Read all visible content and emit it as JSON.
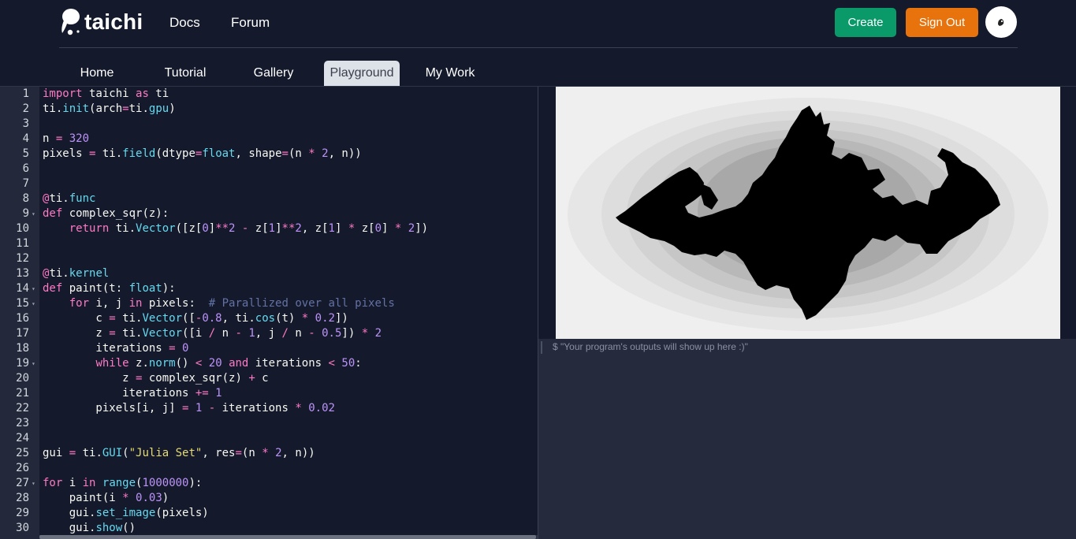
{
  "brand": {
    "name": "taichi"
  },
  "nav": {
    "docs": "Docs",
    "forum": "Forum"
  },
  "actions": {
    "create": "Create",
    "sign_out": "Sign Out",
    "create_color": "#0a9a6a",
    "sign_out_color": "#e8730c"
  },
  "tabs": [
    "Home",
    "Tutorial",
    "Gallery",
    "Playground",
    "My Work"
  ],
  "active_tab": "Playground",
  "code": [
    [
      [
        "k",
        "import"
      ],
      [
        "t",
        " taichi "
      ],
      [
        "k",
        "as"
      ],
      [
        "t",
        " ti"
      ]
    ],
    [
      [
        "t",
        "ti."
      ],
      [
        "f",
        "init"
      ],
      [
        "t",
        "(arch"
      ],
      [
        "k",
        "="
      ],
      [
        "t",
        "ti."
      ],
      [
        "f",
        "gpu"
      ],
      [
        "t",
        ")"
      ]
    ],
    [],
    [
      [
        "t",
        "n "
      ],
      [
        "k",
        "="
      ],
      [
        "t",
        " "
      ],
      [
        "n",
        "320"
      ]
    ],
    [
      [
        "t",
        "pixels "
      ],
      [
        "k",
        "="
      ],
      [
        "t",
        " ti."
      ],
      [
        "f",
        "field"
      ],
      [
        "t",
        "(dtype"
      ],
      [
        "k",
        "="
      ],
      [
        "f",
        "float"
      ],
      [
        "t",
        ", shape"
      ],
      [
        "k",
        "="
      ],
      [
        "t",
        "(n "
      ],
      [
        "k",
        "*"
      ],
      [
        "t",
        " "
      ],
      [
        "n",
        "2"
      ],
      [
        "t",
        ", n))"
      ]
    ],
    [],
    [],
    [
      [
        "k",
        "@"
      ],
      [
        "t",
        "ti."
      ],
      [
        "f",
        "func"
      ]
    ],
    [
      [
        "k",
        "def"
      ],
      [
        "t",
        " complex_sqr(z):"
      ]
    ],
    [
      [
        "t",
        "    "
      ],
      [
        "k",
        "return"
      ],
      [
        "t",
        " ti."
      ],
      [
        "f",
        "Vector"
      ],
      [
        "t",
        "([z["
      ],
      [
        "n",
        "0"
      ],
      [
        "t",
        "]"
      ],
      [
        "k",
        "**"
      ],
      [
        "n",
        "2"
      ],
      [
        "t",
        " "
      ],
      [
        "k",
        "-"
      ],
      [
        "t",
        " z["
      ],
      [
        "n",
        "1"
      ],
      [
        "t",
        "]"
      ],
      [
        "k",
        "**"
      ],
      [
        "n",
        "2"
      ],
      [
        "t",
        ", z["
      ],
      [
        "n",
        "1"
      ],
      [
        "t",
        "] "
      ],
      [
        "k",
        "*"
      ],
      [
        "t",
        " z["
      ],
      [
        "n",
        "0"
      ],
      [
        "t",
        "] "
      ],
      [
        "k",
        "*"
      ],
      [
        "t",
        " "
      ],
      [
        "n",
        "2"
      ],
      [
        "t",
        "])"
      ]
    ],
    [],
    [],
    [
      [
        "k",
        "@"
      ],
      [
        "t",
        "ti."
      ],
      [
        "f",
        "kernel"
      ]
    ],
    [
      [
        "k",
        "def"
      ],
      [
        "t",
        " paint(t: "
      ],
      [
        "f",
        "float"
      ],
      [
        "t",
        "):"
      ]
    ],
    [
      [
        "t",
        "    "
      ],
      [
        "k",
        "for"
      ],
      [
        "t",
        " i, j "
      ],
      [
        "k",
        "in"
      ],
      [
        "t",
        " pixels:  "
      ],
      [
        "c",
        "# Parallized over all pixels"
      ]
    ],
    [
      [
        "t",
        "        c "
      ],
      [
        "k",
        "="
      ],
      [
        "t",
        " ti."
      ],
      [
        "f",
        "Vector"
      ],
      [
        "t",
        "(["
      ],
      [
        "k",
        "-"
      ],
      [
        "n",
        "0.8"
      ],
      [
        "t",
        ", ti."
      ],
      [
        "f",
        "cos"
      ],
      [
        "t",
        "(t) "
      ],
      [
        "k",
        "*"
      ],
      [
        "t",
        " "
      ],
      [
        "n",
        "0.2"
      ],
      [
        "t",
        "])"
      ]
    ],
    [
      [
        "t",
        "        z "
      ],
      [
        "k",
        "="
      ],
      [
        "t",
        " ti."
      ],
      [
        "f",
        "Vector"
      ],
      [
        "t",
        "([i "
      ],
      [
        "k",
        "/"
      ],
      [
        "t",
        " n "
      ],
      [
        "k",
        "-"
      ],
      [
        "t",
        " "
      ],
      [
        "n",
        "1"
      ],
      [
        "t",
        ", j "
      ],
      [
        "k",
        "/"
      ],
      [
        "t",
        " n "
      ],
      [
        "k",
        "-"
      ],
      [
        "t",
        " "
      ],
      [
        "n",
        "0.5"
      ],
      [
        "t",
        "]) "
      ],
      [
        "k",
        "*"
      ],
      [
        "t",
        " "
      ],
      [
        "n",
        "2"
      ]
    ],
    [
      [
        "t",
        "        iterations "
      ],
      [
        "k",
        "="
      ],
      [
        "t",
        " "
      ],
      [
        "n",
        "0"
      ]
    ],
    [
      [
        "t",
        "        "
      ],
      [
        "k",
        "while"
      ],
      [
        "t",
        " z."
      ],
      [
        "f",
        "norm"
      ],
      [
        "t",
        "() "
      ],
      [
        "k",
        "<"
      ],
      [
        "t",
        " "
      ],
      [
        "n",
        "20"
      ],
      [
        "t",
        " "
      ],
      [
        "k",
        "and"
      ],
      [
        "t",
        " iterations "
      ],
      [
        "k",
        "<"
      ],
      [
        "t",
        " "
      ],
      [
        "n",
        "50"
      ],
      [
        "t",
        ":"
      ]
    ],
    [
      [
        "t",
        "            z "
      ],
      [
        "k",
        "="
      ],
      [
        "t",
        " complex_sqr(z) "
      ],
      [
        "k",
        "+"
      ],
      [
        "t",
        " c"
      ]
    ],
    [
      [
        "t",
        "            iterations "
      ],
      [
        "k",
        "+="
      ],
      [
        "t",
        " "
      ],
      [
        "n",
        "1"
      ]
    ],
    [
      [
        "t",
        "        pixels[i, j] "
      ],
      [
        "k",
        "="
      ],
      [
        "t",
        " "
      ],
      [
        "n",
        "1"
      ],
      [
        "t",
        " "
      ],
      [
        "k",
        "-"
      ],
      [
        "t",
        " iterations "
      ],
      [
        "k",
        "*"
      ],
      [
        "t",
        " "
      ],
      [
        "n",
        "0.02"
      ]
    ],
    [],
    [],
    [
      [
        "t",
        "gui "
      ],
      [
        "k",
        "="
      ],
      [
        "t",
        " ti."
      ],
      [
        "f",
        "GUI"
      ],
      [
        "t",
        "("
      ],
      [
        "s",
        "\"Julia Set\""
      ],
      [
        "t",
        ", res"
      ],
      [
        "k",
        "="
      ],
      [
        "t",
        "(n "
      ],
      [
        "k",
        "*"
      ],
      [
        "t",
        " "
      ],
      [
        "n",
        "2"
      ],
      [
        "t",
        ", n))"
      ]
    ],
    [],
    [
      [
        "k",
        "for"
      ],
      [
        "t",
        " i "
      ],
      [
        "k",
        "in"
      ],
      [
        "t",
        " "
      ],
      [
        "f",
        "range"
      ],
      [
        "t",
        "("
      ],
      [
        "n",
        "1000000"
      ],
      [
        "t",
        "):"
      ]
    ],
    [
      [
        "t",
        "    paint(i "
      ],
      [
        "k",
        "*"
      ],
      [
        "t",
        " "
      ],
      [
        "n",
        "0.03"
      ],
      [
        "t",
        ")"
      ]
    ],
    [
      [
        "t",
        "    gui."
      ],
      [
        "f",
        "set_image"
      ],
      [
        "t",
        "(pixels)"
      ]
    ],
    [
      [
        "t",
        "    gui."
      ],
      [
        "f",
        "show"
      ],
      [
        "t",
        "()"
      ]
    ]
  ],
  "fold_lines": [
    9,
    14,
    15,
    19,
    27
  ],
  "console": {
    "placeholder": "$ \"Your program's outputs will show up here :)\""
  }
}
